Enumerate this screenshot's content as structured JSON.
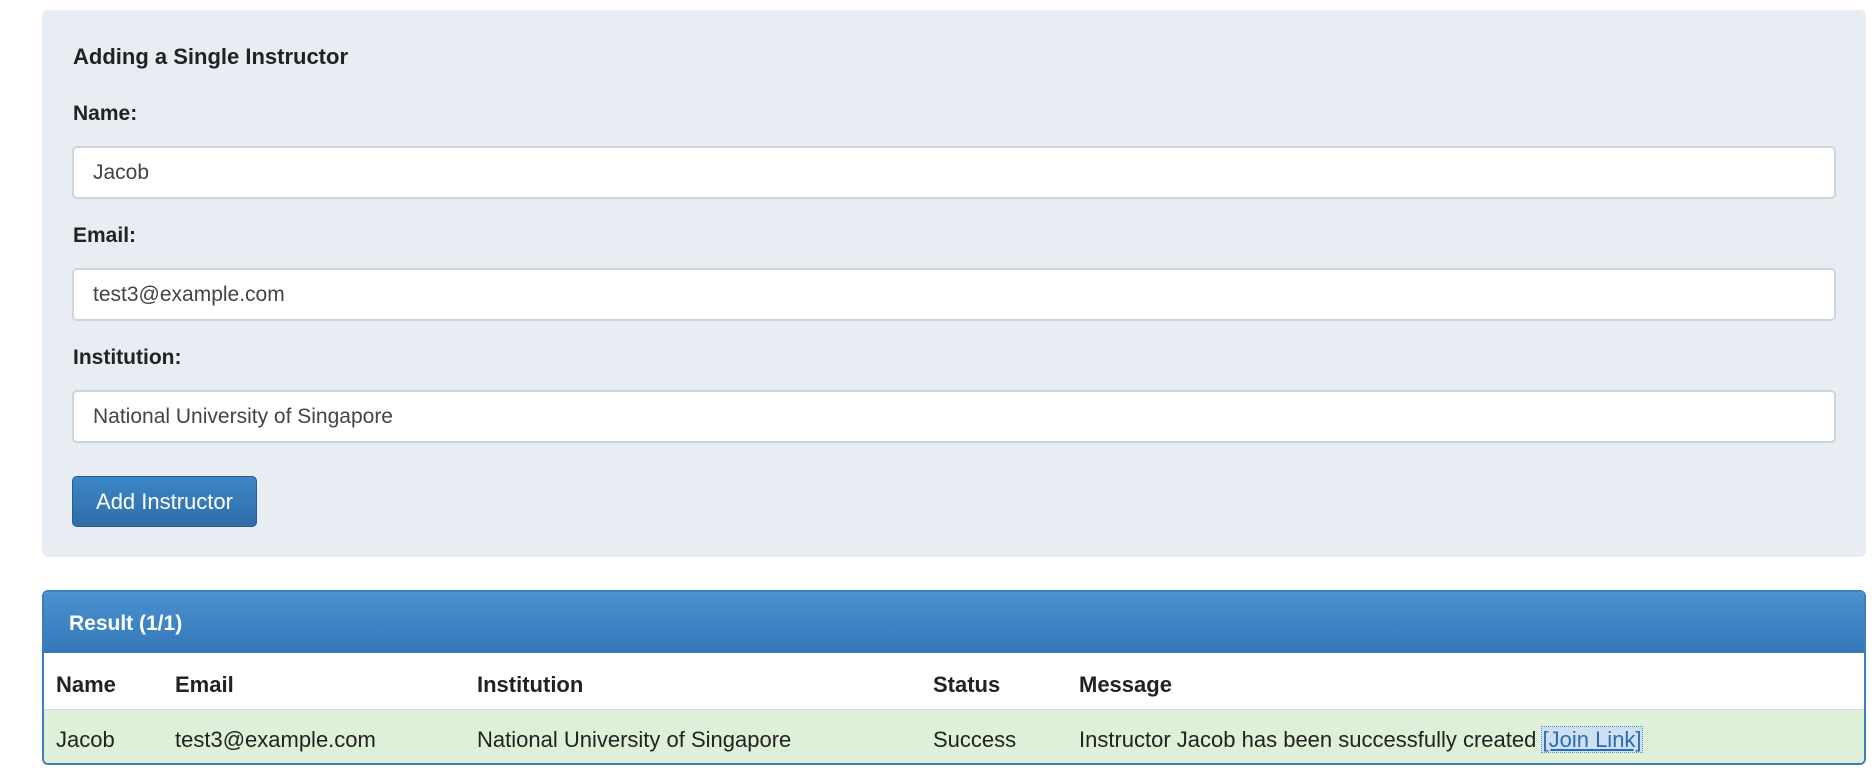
{
  "form": {
    "title": "Adding a Single Instructor",
    "name_label": "Name:",
    "name_value": "Jacob",
    "email_label": "Email:",
    "email_value": "test3@example.com",
    "institution_label": "Institution:",
    "institution_value": "National University of Singapore",
    "submit_label": "Add Instructor"
  },
  "result": {
    "title": "Result (1/1)",
    "columns": [
      "Name",
      "Email",
      "Institution",
      "Status",
      "Message"
    ],
    "rows": [
      {
        "name": "Jacob",
        "email": "test3@example.com",
        "institution": "National University of Singapore",
        "status": "Success",
        "message": "Instructor Jacob has been successfully created",
        "link_text": "[Join Link]"
      }
    ]
  },
  "colors": {
    "panel_bg": "#e8edf4",
    "primary": "#337ab7",
    "success_row": "#dff0d8"
  }
}
